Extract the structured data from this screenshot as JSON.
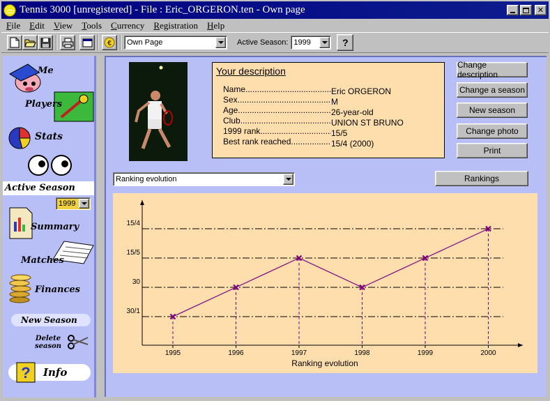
{
  "window": {
    "title": "Tennis 3000 [unregistered] - File : Eric_ORGERON.ten - Own page",
    "icon": "tennis-ball-icon",
    "controls": [
      "minimize-icon",
      "maximize-icon",
      "close-icon"
    ]
  },
  "menu": [
    "File",
    "Edit",
    "View",
    "Tools",
    "Currency",
    "Registration",
    "Help"
  ],
  "toolbar": {
    "buttons": [
      "new-file-icon",
      "open-folder-icon",
      "save-disk-icon",
      "print-icon",
      "window-icon",
      "coin-icon"
    ],
    "page_select": "Own Page",
    "season_label": "Active Season:",
    "season_value": "1999",
    "help_button": "?"
  },
  "nav": {
    "items": [
      "Me",
      "Players",
      "Stats",
      "Active Season",
      "Summary",
      "Matches",
      "Finances",
      "New Season",
      "Delete season",
      "Info"
    ],
    "season_select": "1999"
  },
  "description": {
    "title": "Your description",
    "rows": [
      {
        "label": "Name",
        "value": "Eric ORGERON"
      },
      {
        "label": "Sex",
        "value": "M"
      },
      {
        "label": "Age",
        "value": "26-year-old"
      },
      {
        "label": "Club",
        "value": "UNION ST BRUNO"
      },
      {
        "label": "1999 rank",
        "value": "15/5"
      },
      {
        "label": "Best rank reached",
        "value": "15/4 (2000)"
      }
    ]
  },
  "actions": {
    "change_description": "Change description",
    "change_season": "Change a season",
    "new_season": "New season",
    "change_photo": "Change photo",
    "print": "Print",
    "rankings": "Rankings"
  },
  "chart_select": "Ranking evolution",
  "chart_data": {
    "type": "line",
    "x": [
      "1995",
      "1996",
      "1997",
      "1998",
      "1999",
      "2000"
    ],
    "y_categories": [
      "30/1",
      "30",
      "15/5",
      "15/4"
    ],
    "series": [
      {
        "values": [
          "30/1",
          "30",
          "15/5",
          "30",
          "15/5",
          "15/4"
        ]
      }
    ],
    "xlabel": "Ranking evolution",
    "ylabel": "",
    "grid": true,
    "marker": "x",
    "line_color": "#800080",
    "grid_style": "dash-dot"
  },
  "colors": {
    "panel_bg": "#b8bff6",
    "card_bg": "#ffdead",
    "titlebar": "#000080",
    "series": "#800080"
  }
}
